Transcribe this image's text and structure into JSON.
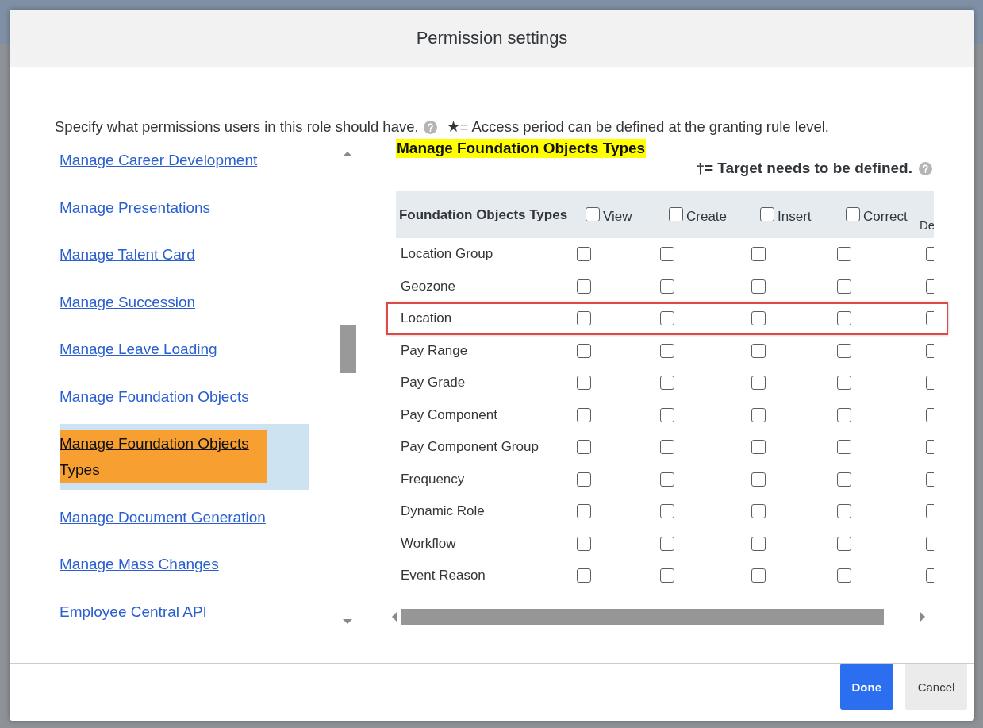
{
  "dialog": {
    "title": "Permission settings",
    "intro": "Specify what permissions users in this role should have.",
    "access_note": "★= Access period can be defined at the granting rule level."
  },
  "categories": [
    {
      "label": "Manage Career Development",
      "selected": false
    },
    {
      "label": "Manage Presentations",
      "selected": false
    },
    {
      "label": "Manage Talent Card",
      "selected": false
    },
    {
      "label": "Manage Succession",
      "selected": false
    },
    {
      "label": "Manage Leave Loading",
      "selected": false
    },
    {
      "label": "Manage Foundation Objects",
      "selected": false
    },
    {
      "label": "Manage Foundation Objects Types",
      "selected": true
    },
    {
      "label": "Manage Document Generation",
      "selected": false
    },
    {
      "label": "Manage Mass Changes",
      "selected": false
    },
    {
      "label": "Employee Central API",
      "selected": false
    }
  ],
  "panel": {
    "heading": "Manage Foundation Objects Types",
    "target_note": "†= Target needs to be defined.",
    "columns": [
      {
        "label": "Foundation Objects Types",
        "kind": "name"
      },
      {
        "label": "View",
        "kind": "check",
        "checked": false
      },
      {
        "label": "Create",
        "kind": "check",
        "checked": false
      },
      {
        "label": "Insert",
        "kind": "check",
        "checked": false
      },
      {
        "label": "Correct",
        "kind": "check",
        "checked": false
      },
      {
        "label": "De",
        "kind": "cut"
      }
    ],
    "rows": [
      {
        "name": "Location Group",
        "highlighted": false,
        "checks": [
          false,
          false,
          false,
          false,
          false
        ]
      },
      {
        "name": "Geozone",
        "highlighted": false,
        "checks": [
          false,
          false,
          false,
          false,
          false
        ]
      },
      {
        "name": "Location",
        "highlighted": true,
        "checks": [
          false,
          false,
          false,
          false,
          false
        ]
      },
      {
        "name": "Pay Range",
        "highlighted": false,
        "checks": [
          false,
          false,
          false,
          false,
          false
        ]
      },
      {
        "name": "Pay Grade",
        "highlighted": false,
        "checks": [
          false,
          false,
          false,
          false,
          false
        ]
      },
      {
        "name": "Pay Component",
        "highlighted": false,
        "checks": [
          false,
          false,
          false,
          false,
          false
        ]
      },
      {
        "name": "Pay Component Group",
        "highlighted": false,
        "checks": [
          false,
          false,
          false,
          false,
          false
        ]
      },
      {
        "name": "Frequency",
        "highlighted": false,
        "checks": [
          false,
          false,
          false,
          false,
          false
        ]
      },
      {
        "name": "Dynamic Role",
        "highlighted": false,
        "checks": [
          false,
          false,
          false,
          false,
          false
        ]
      },
      {
        "name": "Workflow",
        "highlighted": false,
        "checks": [
          false,
          false,
          false,
          false,
          false
        ]
      },
      {
        "name": "Event Reason",
        "highlighted": false,
        "checks": [
          false,
          false,
          false,
          false,
          false
        ]
      }
    ]
  },
  "buttons": [
    {
      "label": "Done",
      "kind": "primary"
    },
    {
      "label": "Cancel",
      "kind": "secondary"
    }
  ]
}
